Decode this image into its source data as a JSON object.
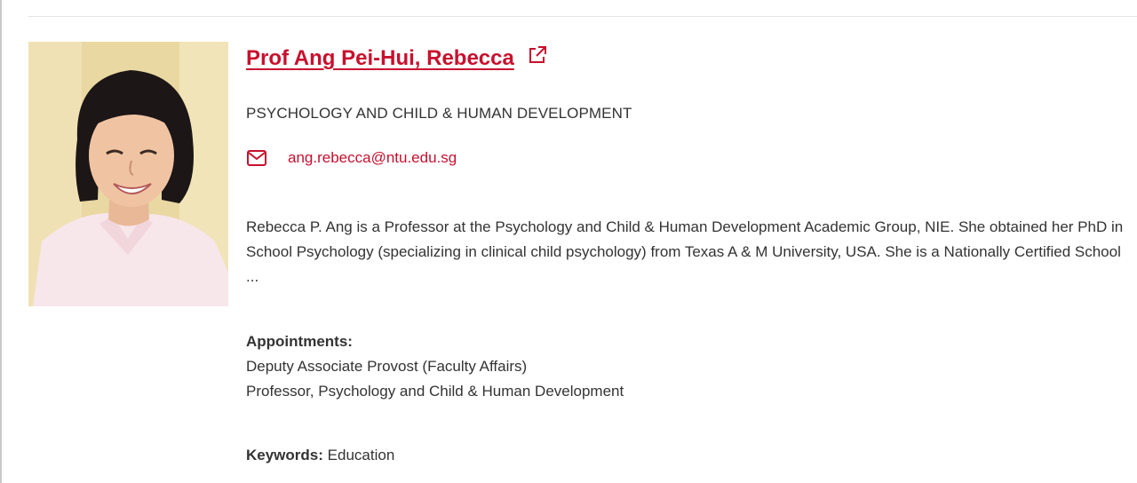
{
  "profile": {
    "name": "Prof Ang Pei-Hui, Rebecca",
    "department": "PSYCHOLOGY AND CHILD & HUMAN DEVELOPMENT",
    "email": "ang.rebecca@ntu.edu.sg",
    "bio": "Rebecca P. Ang is a Professor at the Psychology and Child & Human Development Academic Group, NIE. She obtained her PhD in School Psychology (specializing in clinical child psychology) from Texas A & M University, USA. She is a Nationally Certified School ...",
    "appointments": {
      "heading": "Appointments:",
      "items": [
        "Deputy Associate Provost (Faculty Affairs)",
        "Professor, Psychology and Child & Human Development"
      ]
    },
    "keywords": {
      "label": "Keywords:",
      "value": "Education"
    }
  },
  "icons": {
    "external_link": "external-link-icon",
    "mail": "mail-icon",
    "photo": "profile-photo"
  },
  "colors": {
    "accent": "#c8102e",
    "text": "#333333",
    "divider": "#e4e4e4"
  }
}
